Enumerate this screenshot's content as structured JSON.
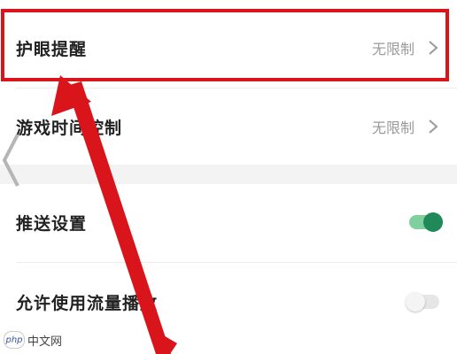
{
  "settings": {
    "items": [
      {
        "label": "护眼提醒",
        "value": "无限制"
      },
      {
        "label": "游戏时间控制",
        "value": "无限制"
      },
      {
        "label": "推送设置",
        "toggle": "on"
      },
      {
        "label": "允许使用流量播放",
        "toggle": "off"
      }
    ]
  },
  "watermark": {
    "logo": "php",
    "text": "中文网"
  },
  "colors": {
    "highlight": "#d9151b",
    "arrow": "#d9151b",
    "toggle_on": "#1f8a57",
    "toggle_off": "#e6e6e6"
  },
  "icons": {
    "chevron": "chevron-right-icon",
    "back": "chevron-left-icon"
  }
}
